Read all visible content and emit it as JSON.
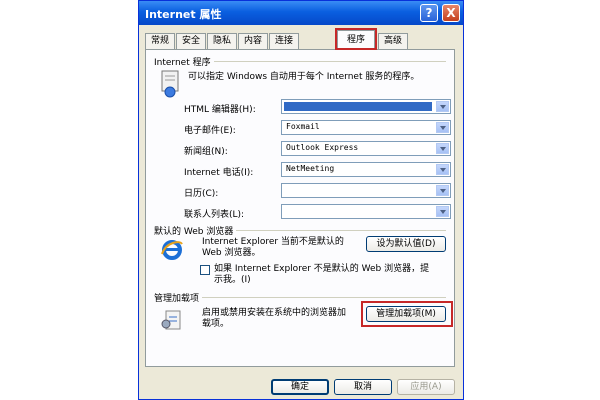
{
  "window": {
    "title": "Internet 属性",
    "help_glyph": "?",
    "close_glyph": "X"
  },
  "tabs": [
    {
      "label": "常规"
    },
    {
      "label": "安全"
    },
    {
      "label": "隐私"
    },
    {
      "label": "内容"
    },
    {
      "label": "连接"
    },
    {
      "label": "程序"
    },
    {
      "label": "高级"
    }
  ],
  "active_tab": "程序",
  "programs": {
    "group_title": "Internet 程序",
    "description": "可以指定 Windows 自动用于每个 Internet 服务的程序。",
    "fields": [
      {
        "label": "HTML 编辑器(H):",
        "value": ""
      },
      {
        "label": "电子邮件(E):",
        "value": "Foxmail"
      },
      {
        "label": "新闻组(N):",
        "value": "Outlook Express"
      },
      {
        "label": "Internet 电话(I):",
        "value": "NetMeeting"
      },
      {
        "label": "日历(C):",
        "value": ""
      },
      {
        "label": "联系人列表(L):",
        "value": ""
      }
    ]
  },
  "default_browser": {
    "group_title": "默认的 Web 浏览器",
    "status_line1": "Internet Explorer 当前不是默认的",
    "status_line2": "Web 浏览器。",
    "set_default_button": "设为默认值(D)",
    "checkbox_line1": "如果 Internet Explorer 不是默认的 Web 浏览器，提",
    "checkbox_line2": "示我。(I)"
  },
  "addons": {
    "group_title": "管理加载项",
    "description_line1": "启用或禁用安装在系统中的浏览器加",
    "description_line2": "载项。",
    "manage_button": "管理加载项(M)"
  },
  "footer": {
    "ok": "确定",
    "cancel": "取消",
    "apply": "应用(A)"
  },
  "colors": {
    "highlight_red": "#c62828",
    "titlebar_blue": "#0a5fe0",
    "selection_blue": "#316ac5"
  }
}
